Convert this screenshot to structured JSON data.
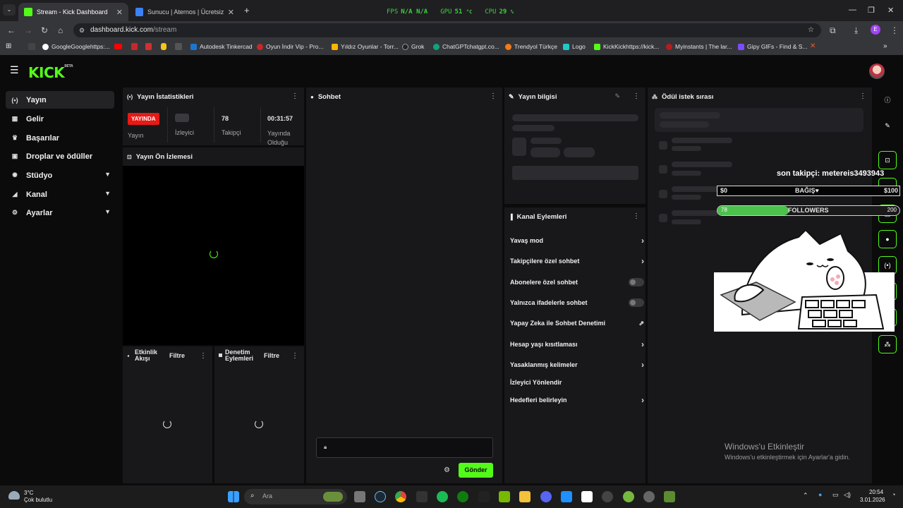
{
  "browser": {
    "tabs": [
      {
        "title": "Stream - Kick Dashboard"
      },
      {
        "title": "Sunucu | Aternos | Ücretsiz Min"
      }
    ],
    "new_tab": "+",
    "url_host": "dashboard.kick.com",
    "url_path": "/stream",
    "bookmarks": [
      "GoogleGooglehttps:...",
      "Autodesk Tinkercad",
      "Oyun İndir Vip - Pro...",
      "Yıldız Oyunlar - Torr...",
      "Grok",
      "ChatGPTchatgpt.co...",
      "Trendyol Türkçe",
      "Logo",
      "KickKickhttps://kick...",
      "Myinstants | The lar...",
      "Gipy GIFs - Find & S..."
    ],
    "profile_initial": "E"
  },
  "hw_monitor": {
    "fps_label": "FPS",
    "fps_value": "N/A",
    "fps_value2": "N/A",
    "gpu_label": "GPU",
    "gpu_value": "51",
    "gpu_unit": "°C",
    "cpu_label": "CPU",
    "cpu_value": "29",
    "cpu_unit": "%"
  },
  "app": {
    "logo_text": "KICK",
    "logo_badge": "BETA"
  },
  "sidebar": {
    "items": [
      {
        "label": "Yayın",
        "icon": "broadcast-icon"
      },
      {
        "label": "Gelir",
        "icon": "revenue-icon"
      },
      {
        "label": "Başarılar",
        "icon": "trophy-icon"
      },
      {
        "label": "Droplar ve ödüller",
        "icon": "gift-icon"
      },
      {
        "label": "Stüdyo",
        "icon": "studio-icon"
      },
      {
        "label": "Kanal",
        "icon": "channel-icon"
      },
      {
        "label": "Ayarlar",
        "icon": "settings-icon"
      }
    ]
  },
  "stats": {
    "title": "Yayın İstatistikleri",
    "live_badge": "YAYINDA",
    "live_label": "Yayın",
    "viewers_label": "İzleyici",
    "followers_value": "78",
    "followers_label": "Takipçi",
    "uptime_value": "00:31:57",
    "uptime_label": "Yayında Olduğu"
  },
  "preview": {
    "title": "Yayın Ön İzlemesi"
  },
  "activity": {
    "title": "Etkinlik Akışı",
    "filter": "Filtre"
  },
  "moderation": {
    "title": "Denetim Eylemleri",
    "filter": "Filtre"
  },
  "chat": {
    "title": "Sohbet",
    "send_label": "Gönder"
  },
  "stream_info": {
    "title": "Yayın bilgisi"
  },
  "channel_actions": {
    "title": "Kanal Eylemleri",
    "items": [
      {
        "label": "Yavaş mod"
      },
      {
        "label": "Takipçilere özel sohbet"
      },
      {
        "label": "Abonelere özel sohbet"
      },
      {
        "label": "Yalnızca ifadelerle sohbet"
      },
      {
        "label": "Yapay Zeka ile Sohbet Denetimi"
      },
      {
        "label": "Hesap yaşı kısıtlaması"
      },
      {
        "label": "Yasaklanmış kelimeler"
      },
      {
        "label": "İzleyici Yönlendir"
      },
      {
        "label": "Hedefleri belirleyin"
      }
    ]
  },
  "rewards": {
    "title": "Ödül istek sırası"
  },
  "overlay": {
    "last_follower": "son takipçi: metereis3493943",
    "donation_left": "$0",
    "donation_label": "BAĞIŞ♥",
    "donation_right": "$100",
    "followers_current": "78",
    "followers_label": "FOLLOWERS",
    "followers_goal": "200",
    "followers_progress": 0.39
  },
  "watermark": {
    "title": "Windows'u Etkinleştir",
    "subtitle": "Windows'u etkinleştirmek için Ayarlar'a gidin."
  },
  "taskbar": {
    "weather_temp": "3°C",
    "weather_desc": "Çok bulutlu",
    "search_placeholder": "Ara",
    "time": "20:54",
    "date": "3.01.2026"
  },
  "colors": {
    "accent": "#53fc18",
    "live": "#e91916",
    "panel": "#18181b"
  }
}
